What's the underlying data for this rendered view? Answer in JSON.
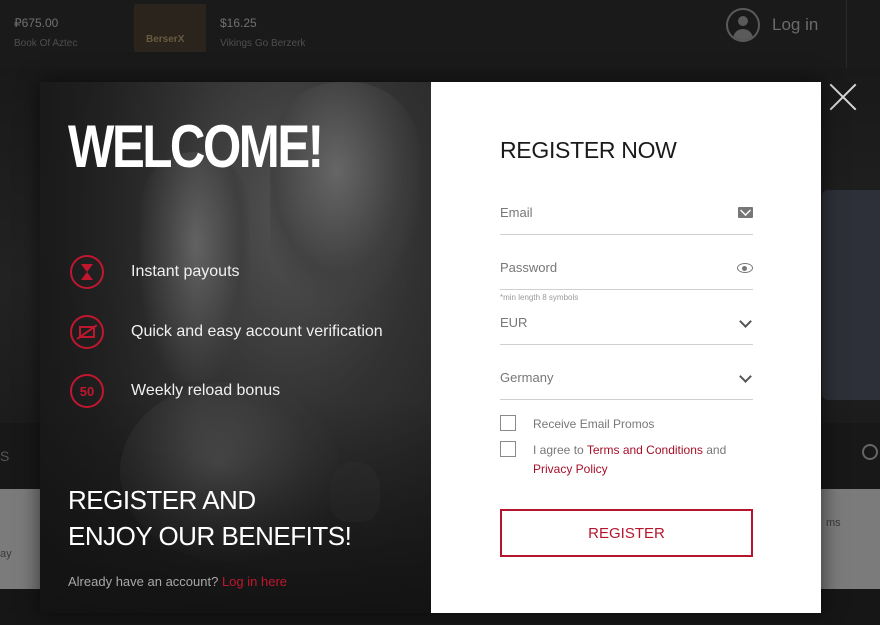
{
  "background": {
    "recent_wins": [
      {
        "amount": "₽675.00",
        "game": "Book Of Aztec"
      },
      {
        "amount": "$16.25",
        "game": "Vikings Go Berzerk"
      }
    ],
    "thumb_label": "BerserX",
    "login_label": "Log in"
  },
  "modal": {
    "close_icon": "close-icon",
    "welcome_title": "WELCOME!",
    "benefits": [
      {
        "icon": "hourglass-icon",
        "label": "Instant payouts"
      },
      {
        "icon": "id-card-icon",
        "label": "Quick and easy account verification"
      },
      {
        "icon": "badge-50-icon",
        "badge": "50",
        "label": "Weekly reload bonus"
      }
    ],
    "register_promo_line1": "REGISTER AND",
    "register_promo_line2": "ENJOY OUR BENEFITS!",
    "already_text": "Already have an account?",
    "login_link": "Log in here",
    "form": {
      "title": "REGISTER NOW",
      "email_label": "Email",
      "password_label": "Password",
      "password_hint": "*min length 8 symbols",
      "currency_value": "EUR",
      "country_value": "Germany",
      "promo_checkbox_label": "Receive Email Promos",
      "terms_prefix": "I agree to ",
      "terms_link": "Terms and Conditions",
      "terms_and": " and",
      "privacy_link": "Privacy Policy",
      "submit_label": "REGISTER"
    }
  },
  "colors": {
    "accent": "#c0172f",
    "panel_bg": "#ffffff"
  }
}
